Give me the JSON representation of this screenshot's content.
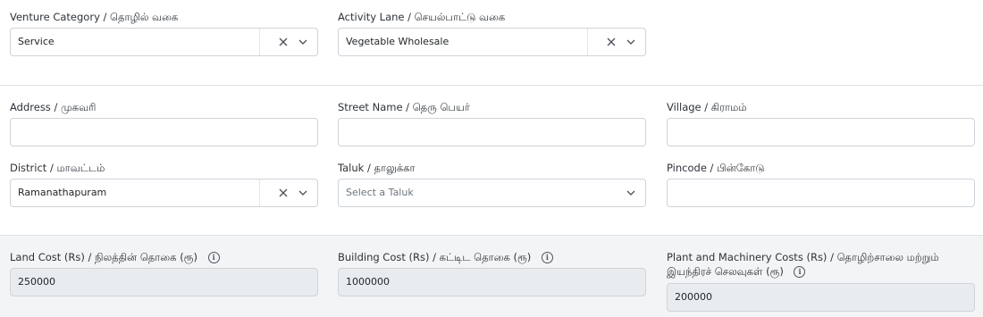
{
  "venture": {
    "category_label": "Venture Category / தொழில் வகை",
    "category_value": "Service",
    "activity_label": "Activity Lane / செயல்பாட்டு வகை",
    "activity_value": "Vegetable Wholesale"
  },
  "location": {
    "address_label": "Address / முகவரி",
    "address_value": "",
    "street_label": "Street Name / தெரு பெயர்",
    "street_value": "",
    "village_label": "Village / கிராமம்",
    "village_value": "",
    "district_label": "District / மாவட்டம்",
    "district_value": "Ramanathapuram",
    "taluk_label": "Taluk / தாலுக்கா",
    "taluk_placeholder": "Select a Taluk",
    "pincode_label": "Pincode / பின்கோடு",
    "pincode_value": ""
  },
  "costs": {
    "land_label": "Land Cost (Rs) / நிலத்தின் தொகை (ரூ)",
    "land_value": "250000",
    "building_label": "Building Cost (Rs) / கட்டிட தொகை (ரூ)",
    "building_value": "1000000",
    "plant_label_line1": "Plant and Machinery Costs (Rs) / தொழிற்சாலை மற்றும்",
    "plant_label_line2": "இயந்திரச் செலவுகள் (ரூ)",
    "plant_value": "200000",
    "info_icon_glyph": "i"
  },
  "icons": {
    "clear": "close-icon",
    "dropdown": "chevron-down-icon",
    "info": "info-icon"
  }
}
